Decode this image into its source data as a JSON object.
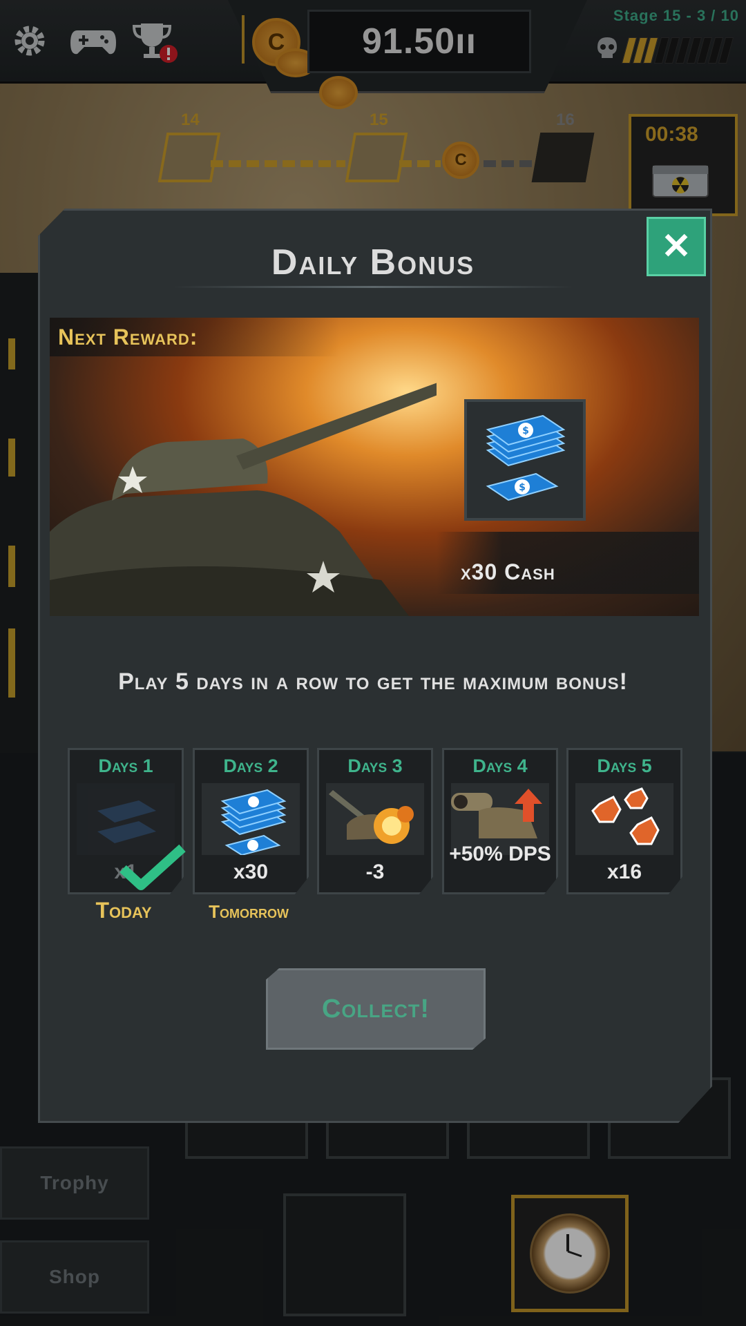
{
  "hud": {
    "currency_value": "91.50ıı",
    "coin_glyph": "C",
    "stage_text": "Stage 15 - 3 / 10",
    "stage_progress_filled": 3,
    "stage_progress_total": 10,
    "chest_timer": "00:38",
    "path_nodes": [
      "14",
      "15",
      "16"
    ]
  },
  "side_menu": {
    "trophy_label": "Trophy",
    "shop_label": "Shop"
  },
  "modal": {
    "title": "Daily Bonus",
    "close_glyph": "✕",
    "next_reward_label": "Next Reward:",
    "next_reward_name": "x30 Cash",
    "promo_text": "Play 5 days in a row to get the maximum bonus!",
    "collect_label": "Collect!",
    "days": [
      {
        "label": "Days 1",
        "value": "x1",
        "status": "Today"
      },
      {
        "label": "Days 2",
        "value": "x30",
        "status": "Tomorrow"
      },
      {
        "label": "Days 3",
        "value": "-3",
        "status": ""
      },
      {
        "label": "Days 4",
        "value": "+50% DPS",
        "status": ""
      },
      {
        "label": "Days 5",
        "value": "x16",
        "status": ""
      }
    ]
  },
  "colors": {
    "accent_green": "#3fb48c",
    "gold": "#e7c35a",
    "close_button": "#2ea27a"
  },
  "icons": [
    "gear-icon",
    "gamepad-icon",
    "trophy-icon",
    "skull-icon",
    "chest-icon",
    "cash-icon",
    "tank-icon",
    "medal-icon",
    "clock-icon",
    "check-icon"
  ]
}
